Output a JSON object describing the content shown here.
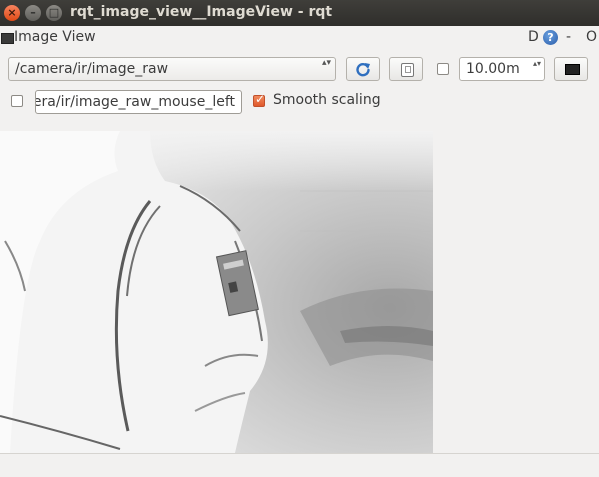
{
  "window": {
    "title": "rqt_image_view__ImageView - rqt",
    "close_glyph": "×",
    "min_glyph": "–",
    "max_glyph": "□"
  },
  "dock": {
    "title": "Image View",
    "d_label": "D",
    "help_label": "?",
    "dash_label": "-",
    "o_label": "O"
  },
  "toolbar": {
    "topic_value": "/camera/ir/image_raw",
    "topic_arrows": "▴▾",
    "rotate_checked": false,
    "spin_value": "10.00m",
    "spin_arrows": "▴▾",
    "mouse_checked": false,
    "mouse_topic_value": "/camera/ir/image_raw_mouse_left",
    "smooth_checked": true,
    "smooth_check_glyph": "✓",
    "smooth_label": "Smooth scaling"
  },
  "icons": {
    "refresh": "refresh-icon",
    "save": "save-icon",
    "fullscreen": "fullscreen-icon"
  },
  "colors": {
    "titlebar": "#3f3e3a",
    "accent_checkbox": "#e0592c",
    "background": "#f2f1f0"
  }
}
